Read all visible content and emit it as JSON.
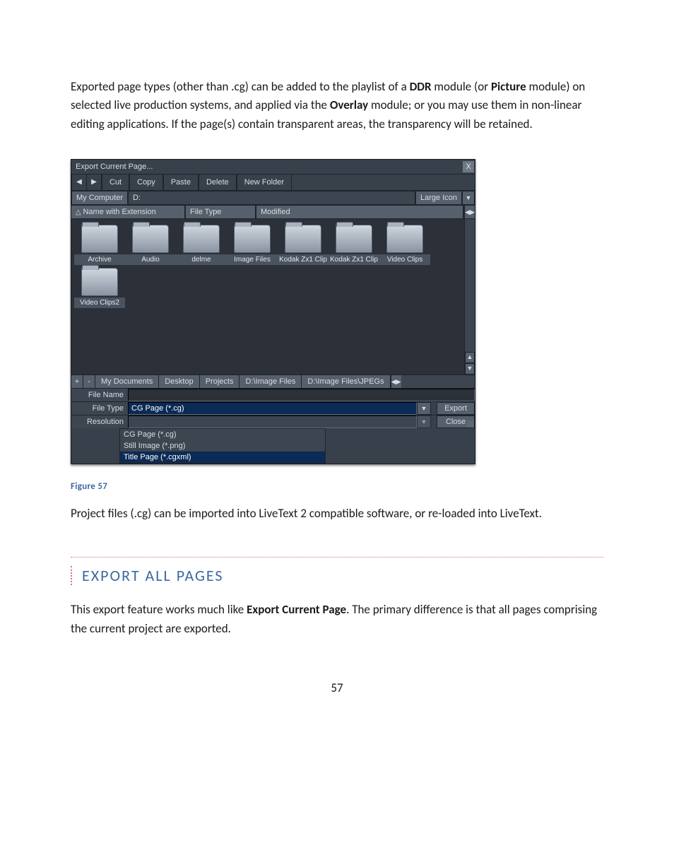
{
  "para1_pre": "Exported page types (other than .cg) can be added to the playlist of a ",
  "para1_b1": "DDR",
  "para1_mid1": " module (or ",
  "para1_b2": "Picture",
  "para1_mid2": " module) on selected live production systems, and applied via the ",
  "para1_b3": "Overlay",
  "para1_post": " module; or you may use them in non-linear editing applications.  If the page(s) contain transparent areas, the transparency will be retained.",
  "dlg": {
    "title": "Export Current Page...",
    "close": "X",
    "nav_back": "◀",
    "nav_fwd": "▶",
    "toolbar": [
      "Cut",
      "Copy",
      "Paste",
      "Delete",
      "New Folder"
    ],
    "path_label": "My Computer",
    "path_value": "D:",
    "view_mode": "Large Icon",
    "dd_glyph": "▼",
    "cols": {
      "name": "Name with Extension",
      "type": "File Type",
      "mod": "Modified"
    },
    "col_scroll": "◀▶",
    "folders": [
      "Archive",
      "Audio",
      "delme",
      "Image Files",
      "Kodak Zx1 Clip",
      "Kodak Zx1 Clip",
      "Video Clips",
      "Video Clips2"
    ],
    "scroll_up": "▲",
    "scroll_dn": "▼",
    "fav_plus": "+",
    "fav_minus": "-",
    "favorites": [
      "My Documents",
      "Desktop",
      "Projects",
      "D:\\Image Files",
      "D:\\Image Files\\JPEGs"
    ],
    "fav_scroll": "◀▶",
    "labels": {
      "fname": "File Name",
      "ftype": "File Type",
      "res": "Resolution"
    },
    "file_name": "",
    "file_type": "CG Page (*.cg)",
    "resolution": "",
    "actions": {
      "export": "Export",
      "close": "Close"
    },
    "options": [
      "CG Page (*.cg)",
      "Still Image (*.png)",
      "Title Page (*.cgxml)"
    ]
  },
  "figcap": "Figure 57",
  "para2": "Project files (.cg) can be imported into LiveText 2 compatible software, or re-loaded into LiveText.",
  "section_h": "EXPORT ALL PAGES",
  "para3_pre": "This export feature works much like ",
  "para3_b": "Export Current Page",
  "para3_post": ". The primary difference is that all pages comprising the current project are exported.",
  "page_number": "57"
}
